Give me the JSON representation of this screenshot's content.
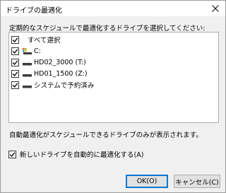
{
  "window": {
    "title": "ドライブの最適化"
  },
  "instruction": "定期的なスケジュールで最適化するドライブを選択してください:",
  "drives": [
    {
      "label": "すべて選択",
      "checked": true,
      "icon": "none"
    },
    {
      "label": "C:",
      "checked": true,
      "icon": "system-drive-icon"
    },
    {
      "label": "HD02_3000 (T:)",
      "checked": true,
      "icon": "drive-icon"
    },
    {
      "label": "HD01_1500 (Z:)",
      "checked": true,
      "icon": "drive-icon"
    },
    {
      "label": "システムで予約済み",
      "checked": true,
      "icon": "drive-icon"
    }
  ],
  "info_text": "自動最適化がスケジュールできるドライブのみが表示されます。",
  "auto_option": {
    "label": "新しいドライブを自動的に最適化する(A)",
    "checked": true
  },
  "buttons": {
    "ok": "OK(O)",
    "cancel": "キャンセル(C)"
  },
  "colors": {
    "accent": "#0078d7",
    "drive_icon": "#3c3c3c",
    "background": "#f0f0f0"
  }
}
